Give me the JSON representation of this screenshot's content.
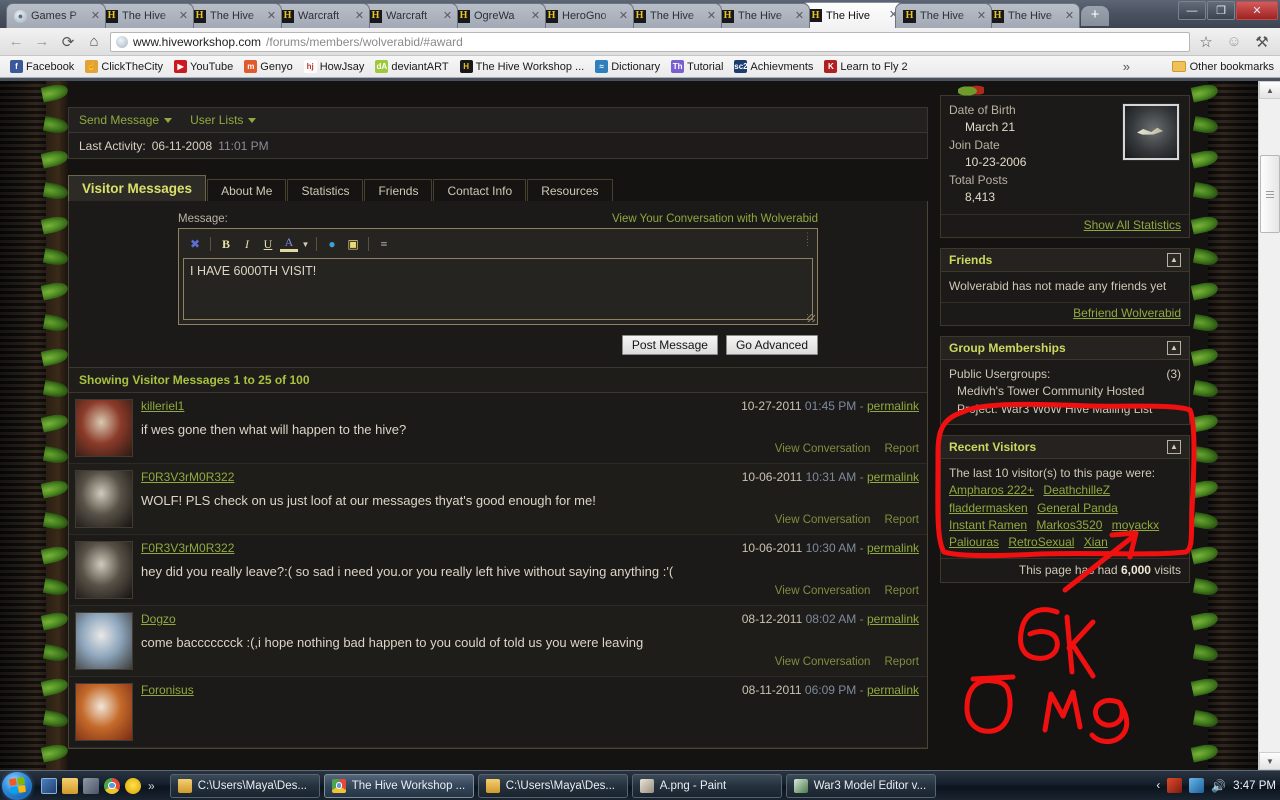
{
  "browser": {
    "tabs": [
      {
        "title": "Games P",
        "favicon": "globe-icon",
        "active": false
      },
      {
        "title": "The Hive",
        "favicon": "hive-icon",
        "active": false
      },
      {
        "title": "The Hive",
        "favicon": "hive-icon",
        "active": false
      },
      {
        "title": "Warcraft",
        "favicon": "hive-icon",
        "active": false
      },
      {
        "title": "Warcraft",
        "favicon": "hive-icon",
        "active": false
      },
      {
        "title": "OgreWa",
        "favicon": "hive-icon",
        "active": false
      },
      {
        "title": "HeroGno",
        "favicon": "hive-icon",
        "active": false
      },
      {
        "title": "The Hive",
        "favicon": "hive-icon",
        "active": false
      },
      {
        "title": "The Hive",
        "favicon": "hive-icon",
        "active": false
      },
      {
        "title": "The Hive",
        "favicon": "hive-icon",
        "active": true
      },
      {
        "title": "The Hive",
        "favicon": "hive-icon",
        "active": false
      },
      {
        "title": "The Hive",
        "favicon": "hive-icon",
        "active": false
      }
    ],
    "new_tab_label": "+",
    "window_buttons": {
      "minimize": "—",
      "maximize": "❐",
      "close": "✕"
    },
    "nav": {
      "back": "←",
      "forward": "→",
      "reload": "⟳",
      "home": "⌂"
    },
    "url_domain": "www.hiveworkshop.com",
    "url_path": "/forums/members/wolverabid/#award",
    "star_icon": "☆",
    "face_icon": "☺",
    "wrench_icon": "⚒",
    "bookmarks": [
      {
        "label": "Facebook",
        "glyph": "f",
        "color": "#3b5998"
      },
      {
        "label": "ClickTheCity",
        "glyph": "☝",
        "color": "#e0a33c"
      },
      {
        "label": "YouTube",
        "glyph": "▶",
        "color": "#cc181e"
      },
      {
        "label": "Genyo",
        "glyph": "m",
        "color": "#e05a2b"
      },
      {
        "label": "HowJsay",
        "glyph": "hj",
        "color": "#ffffff",
        "fg": "#c0392b"
      },
      {
        "label": "deviantART",
        "glyph": "dA",
        "color": "#9fc93c"
      },
      {
        "label": "The Hive Workshop ...",
        "glyph": "H",
        "color": "#16181c",
        "fg": "#f0c420"
      },
      {
        "label": "Dictionary",
        "glyph": "≈",
        "color": "#2f7fbf"
      },
      {
        "label": "Tutorial",
        "glyph": "Th",
        "color": "#7a5fd0"
      },
      {
        "label": "Achievments",
        "glyph": "sc2",
        "color": "#1b3c6e"
      },
      {
        "label": "Learn to Fly 2",
        "glyph": "K",
        "color": "#b02020"
      }
    ],
    "overflow_label": "»",
    "other_bookmarks_label": "Other bookmarks"
  },
  "profile": {
    "actions": [
      {
        "label": "Send Message",
        "has_caret": true
      },
      {
        "label": "User Lists",
        "has_caret": true
      }
    ],
    "last_activity_label": "Last Activity:",
    "last_activity_date": "06-11-2008",
    "last_activity_time": "11:01 PM",
    "tabs": [
      {
        "label": "Visitor Messages",
        "active": true
      },
      {
        "label": "About Me",
        "active": false
      },
      {
        "label": "Statistics",
        "active": false
      },
      {
        "label": "Friends",
        "active": false
      },
      {
        "label": "Contact Info",
        "active": false
      },
      {
        "label": "Resources",
        "active": false
      }
    ]
  },
  "message_form": {
    "label": "Message:",
    "conversation_link": "View Your Conversation with Wolverabid",
    "toolbar_buttons": [
      {
        "name": "remove-formatting-icon",
        "glyph": "✖"
      },
      {
        "name": "bold-icon",
        "glyph": "B"
      },
      {
        "name": "italic-icon",
        "glyph": "I"
      },
      {
        "name": "underline-icon",
        "glyph": "U"
      },
      {
        "name": "font-color-icon",
        "glyph": "A"
      },
      {
        "name": "insert-link-icon",
        "glyph": "●"
      },
      {
        "name": "insert-image-icon",
        "glyph": "▣"
      },
      {
        "name": "wrap-quotes-icon",
        "glyph": "≡"
      }
    ],
    "textarea_value": "I HAVE 6000TH VISIT!",
    "post_button": "Post Message",
    "advanced_button": "Go Advanced"
  },
  "visitor_messages": {
    "showing_text": "Showing Visitor Messages 1 to 25 of 100",
    "view_conversation_label": "View Conversation",
    "report_label": "Report",
    "permalink_label": "permalink",
    "items": [
      {
        "author": "killeriel1",
        "date": "10-27-2011",
        "time": "01:45 PM",
        "text": "if wes gone then what will happen to the hive?",
        "avatar_colors": [
          "#8c3b2a",
          "#d8c9b0",
          "#2a1a12"
        ]
      },
      {
        "author": "F0R3V3rM0R322",
        "date": "10-06-2011",
        "time": "10:31 AM",
        "text": "WOLF! PLS check on us just loof at our messages thyat's good enough for me!",
        "avatar_colors": [
          "#585248",
          "#cfcabb",
          "#16120f"
        ]
      },
      {
        "author": "F0R3V3rM0R322",
        "date": "10-06-2011",
        "time": "10:30 AM",
        "text": "hey did you really leave?:( so sad i need you.or you really left hive without saying anything :'(",
        "avatar_colors": [
          "#585248",
          "#cfcabb",
          "#16120f"
        ]
      },
      {
        "author": "Dogzo",
        "date": "08-12-2011",
        "time": "08:02 AM",
        "text": "come baccccccck :(,i hope nothing bad happen to you could of told us you were leaving",
        "avatar_colors": [
          "#8fa7bd",
          "#e8e8e8",
          "#3a3a3a"
        ]
      },
      {
        "author": "Foronisus",
        "date": "08-11-2011",
        "time": "06:09 PM",
        "text": "",
        "avatar_colors": [
          "#c46a2a",
          "#f0e6d8",
          "#7a2a14"
        ]
      }
    ]
  },
  "sidebar": {
    "statistics": {
      "rows": [
        {
          "label": "Date of Birth",
          "value": "March 21"
        },
        {
          "label": "Join Date",
          "value": "10-23-2006"
        },
        {
          "label": "Total Posts",
          "value": "8,413"
        }
      ],
      "show_all_link": "Show All Statistics"
    },
    "friends": {
      "title": "Friends",
      "body": "Wolverabid has not made any friends yet",
      "action_link": "Befriend Wolverabid"
    },
    "groups": {
      "title": "Group Memberships",
      "public_label": "Public Usergroups:",
      "count": "(3)",
      "list": "Medivh's Tower Community Hosted Project: War3 WoW Hive Mailing List"
    },
    "recent_visitors": {
      "title": "Recent Visitors",
      "intro": "The last 10 visitor(s) to this page were:",
      "visitors": [
        "Ampharos 222+",
        "DeathchilleZ",
        "fladdermasken",
        "General Panda",
        "Instant Ramen",
        "Markos3520",
        "moyackx",
        "Paliouras",
        "RetroSexual",
        "Xian"
      ],
      "visits_prefix": "This page has had",
      "visits_count": "6,000",
      "visits_suffix": "visits"
    },
    "collapse_icon": "▲"
  },
  "annotation": {
    "text_6k": "6K",
    "text_omg": "OMG",
    "color": "#f01010"
  },
  "taskbar": {
    "start_label": "Start",
    "quick_launch": [
      "show-desktop-icon",
      "explorer-icon",
      "media-icon",
      "chrome-icon",
      "smiley-icon"
    ],
    "overflow": "»",
    "buttons": [
      {
        "label": "C:\\Users\\Maya\\Des...",
        "icon": "folder-icon",
        "active": false
      },
      {
        "label": "The Hive Workshop ...",
        "icon": "chrome-icon",
        "active": true
      },
      {
        "label": "C:\\Users\\Maya\\Des...",
        "icon": "folder-icon",
        "active": false
      },
      {
        "label": "A.png - Paint",
        "icon": "paint-icon",
        "active": false
      },
      {
        "label": "War3 Model Editor v...",
        "icon": "editor-icon",
        "active": false
      }
    ],
    "tray_chevron": "‹",
    "clock": "3:47 PM"
  }
}
